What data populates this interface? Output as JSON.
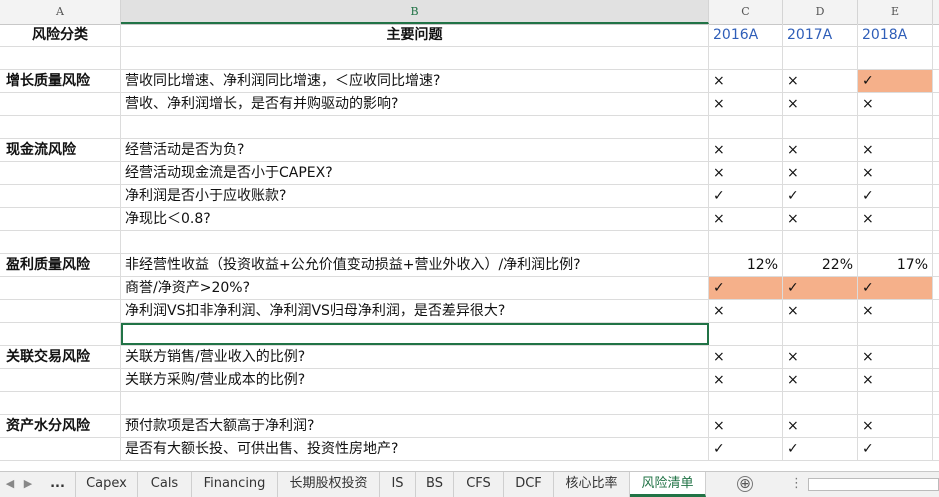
{
  "columns": [
    "A",
    "B",
    "C",
    "D",
    "E"
  ],
  "header": {
    "a": "风险分类",
    "b": "主要问题",
    "c": "2016A",
    "d": "2017A",
    "e": "2018A"
  },
  "rows": [
    {
      "a": "",
      "b": "",
      "c": "",
      "d": "",
      "e": ""
    },
    {
      "a": "增长质量风险",
      "b": "营收同比增速、净利润同比增速，＜应收同比增速?",
      "c": "×",
      "d": "×",
      "e": "✓"
    },
    {
      "a": "",
      "b": "营收、净利润增长，是否有并购驱动的影响?",
      "c": "×",
      "d": "×",
      "e": "×"
    },
    {
      "a": "",
      "b": "",
      "c": "",
      "d": "",
      "e": ""
    },
    {
      "a": "现金流风险",
      "b": "经营活动是否为负?",
      "c": "×",
      "d": "×",
      "e": "×"
    },
    {
      "a": "",
      "b": "经营活动现金流是否小于CAPEX?",
      "c": "×",
      "d": "×",
      "e": "×"
    },
    {
      "a": "",
      "b": "净利润是否小于应收账款?",
      "c": "✓",
      "d": "✓",
      "e": "✓"
    },
    {
      "a": "",
      "b": "净现比＜0.8?",
      "c": "×",
      "d": "×",
      "e": "×"
    },
    {
      "a": "",
      "b": "",
      "c": "",
      "d": "",
      "e": ""
    },
    {
      "a": "盈利质量风险",
      "b": "非经营性收益（投资收益+公允价值变动损益+营业外收入）/净利润比例?",
      "c": "12%",
      "d": "22%",
      "e": "17%"
    },
    {
      "a": "",
      "b": "商誉/净资产>20%?",
      "c": "✓",
      "d": "✓",
      "e": "✓"
    },
    {
      "a": "",
      "b": "净利润VS扣非净利润、净利润VS归母净利润，是否差异很大?",
      "c": "×",
      "d": "×",
      "e": "×"
    },
    {
      "a": "",
      "b": "",
      "c": "",
      "d": "",
      "e": ""
    },
    {
      "a": "关联交易风险",
      "b": "关联方销售/营业收入的比例?",
      "c": "×",
      "d": "×",
      "e": "×"
    },
    {
      "a": "",
      "b": "关联方采购/营业成本的比例?",
      "c": "×",
      "d": "×",
      "e": "×"
    },
    {
      "a": "",
      "b": "",
      "c": "",
      "d": "",
      "e": ""
    },
    {
      "a": "资产水分风险",
      "b": "预付款项是否大额高于净利润?",
      "c": "×",
      "d": "×",
      "e": "×"
    },
    {
      "a": "",
      "b": "是否有大额长投、可供出售、投资性房地产?",
      "c": "✓",
      "d": "✓",
      "e": "✓"
    }
  ],
  "highlight_color": "#f5b08a",
  "tabs": [
    "...",
    "Capex",
    "Cals",
    "Financing",
    "长期股权投资",
    "IS",
    "BS",
    "CFS",
    "DCF",
    "核心比率",
    "风险清单"
  ],
  "active_tab": "风险清单",
  "add_sheet": "⊕",
  "more": "⋮",
  "nav": {
    "prev": "◀",
    "next": "▶"
  },
  "accent_color": "#217346"
}
